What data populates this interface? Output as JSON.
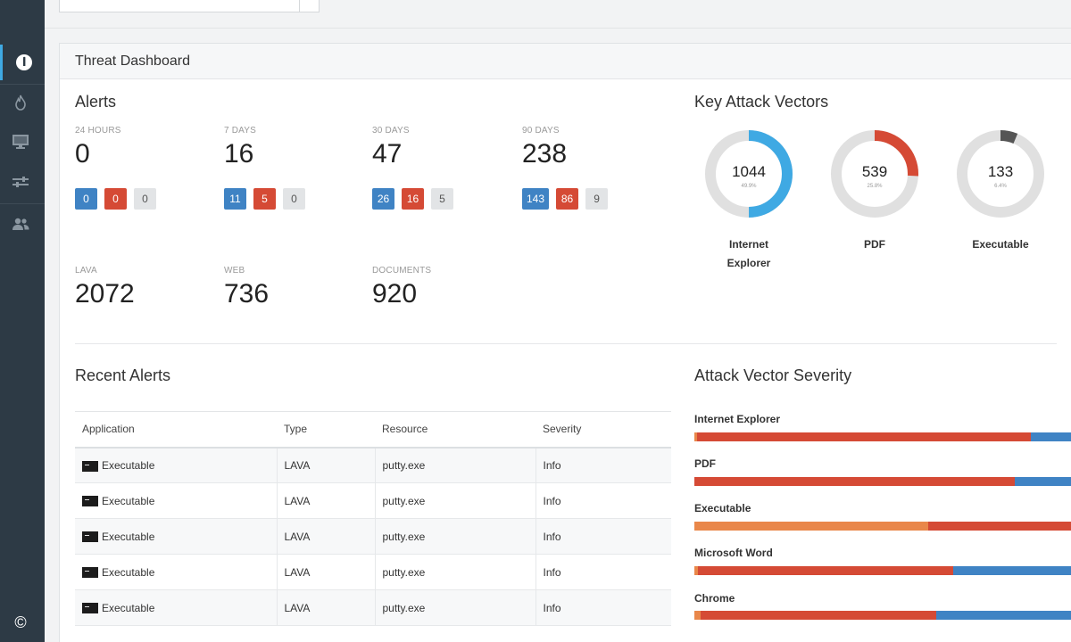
{
  "panel": {
    "title": "Threat Dashboard"
  },
  "alerts": {
    "title": "Alerts",
    "periods": [
      {
        "label": "24 HOURS",
        "value": "0",
        "badges": [
          "0",
          "0",
          "0"
        ]
      },
      {
        "label": "7 DAYS",
        "value": "16",
        "badges": [
          "11",
          "5",
          "0"
        ]
      },
      {
        "label": "30 DAYS",
        "value": "47",
        "badges": [
          "26",
          "16",
          "5"
        ]
      },
      {
        "label": "90 DAYS",
        "value": "238",
        "badges": [
          "143",
          "86",
          "9"
        ]
      }
    ],
    "sources": [
      {
        "label": "LAVA",
        "value": "2072"
      },
      {
        "label": "WEB",
        "value": "736"
      },
      {
        "label": "DOCUMENTS",
        "value": "920"
      }
    ]
  },
  "vectors": {
    "title": "Key Attack Vectors",
    "items": [
      {
        "value": "1044",
        "pct": "49.9%",
        "fraction": 0.499,
        "color": "#3fa9e3",
        "name_line1": "Internet",
        "name_line2": "Explorer"
      },
      {
        "value": "539",
        "pct": "25.8%",
        "fraction": 0.258,
        "color": "#d54a35",
        "name_line1": "PDF",
        "name_line2": ""
      },
      {
        "value": "133",
        "pct": "6.4%",
        "fraction": 0.064,
        "color": "#555555",
        "name_line1": "Executable",
        "name_line2": ""
      }
    ]
  },
  "recent": {
    "title": "Recent Alerts",
    "columns": [
      "Application",
      "Type",
      "Resource",
      "Severity"
    ],
    "rows": [
      {
        "app": "Executable",
        "type": "LAVA",
        "resource": "putty.exe",
        "severity": "Info"
      },
      {
        "app": "Executable",
        "type": "LAVA",
        "resource": "putty.exe",
        "severity": "Info"
      },
      {
        "app": "Executable",
        "type": "LAVA",
        "resource": "putty.exe",
        "severity": "Info"
      },
      {
        "app": "Executable",
        "type": "LAVA",
        "resource": "putty.exe",
        "severity": "Info"
      },
      {
        "app": "Executable",
        "type": "LAVA",
        "resource": "putty.exe",
        "severity": "Info"
      }
    ]
  },
  "severity": {
    "title": "Attack Vector Severity",
    "colors": {
      "orange": "#e9874a",
      "red": "#d54a35",
      "blue": "#3f83c4"
    },
    "items": [
      {
        "name": "Internet Explorer",
        "segments": [
          [
            "orange",
            0.007
          ],
          [
            "red",
            0.85
          ],
          [
            "blue",
            0.143
          ]
        ]
      },
      {
        "name": "PDF",
        "segments": [
          [
            "red",
            0.815
          ],
          [
            "blue",
            0.185
          ]
        ]
      },
      {
        "name": "Executable",
        "segments": [
          [
            "orange",
            0.595
          ],
          [
            "red",
            0.405
          ]
        ]
      },
      {
        "name": "Microsoft Word",
        "segments": [
          [
            "orange",
            0.009
          ],
          [
            "red",
            0.65
          ],
          [
            "blue",
            0.341
          ]
        ]
      },
      {
        "name": "Chrome",
        "segments": [
          [
            "orange",
            0.016
          ],
          [
            "red",
            0.6
          ],
          [
            "blue",
            0.384
          ]
        ]
      }
    ]
  },
  "icons": {
    "sidebar": [
      "dashboard-icon",
      "fire-icon",
      "monitor-icon",
      "sliders-icon",
      "users-icon"
    ],
    "footer": "copyright-icon"
  },
  "footer": {
    "copyright_glyph": "©"
  }
}
